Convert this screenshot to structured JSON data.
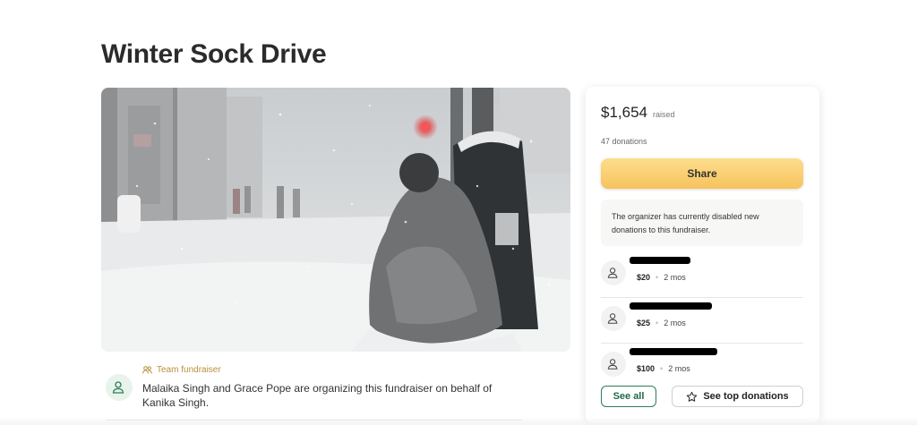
{
  "page": {
    "title": "Winter Sock Drive"
  },
  "organizer": {
    "tag": "Team fundraiser",
    "text": "Malaika Singh and Grace Pope are organizing this fundraiser on behalf of Kanika Singh."
  },
  "sidebar": {
    "raised_amount": "$1,654",
    "raised_label": "raised",
    "donation_count": "47 donations",
    "share_label": "Share",
    "notice": "The organizer has currently disabled new donations to this fundraiser.",
    "donations": [
      {
        "amount": "$20",
        "time": "2 mos"
      },
      {
        "amount": "$25",
        "time": "2 mos"
      },
      {
        "amount": "$100",
        "time": "2 mos"
      }
    ],
    "see_all_label": "See all",
    "see_top_label": "See top donations"
  },
  "colors": {
    "accent_green": "#1f6a46",
    "share_yellow": "#f7c25c",
    "team_tag_gold": "#b8913c"
  }
}
